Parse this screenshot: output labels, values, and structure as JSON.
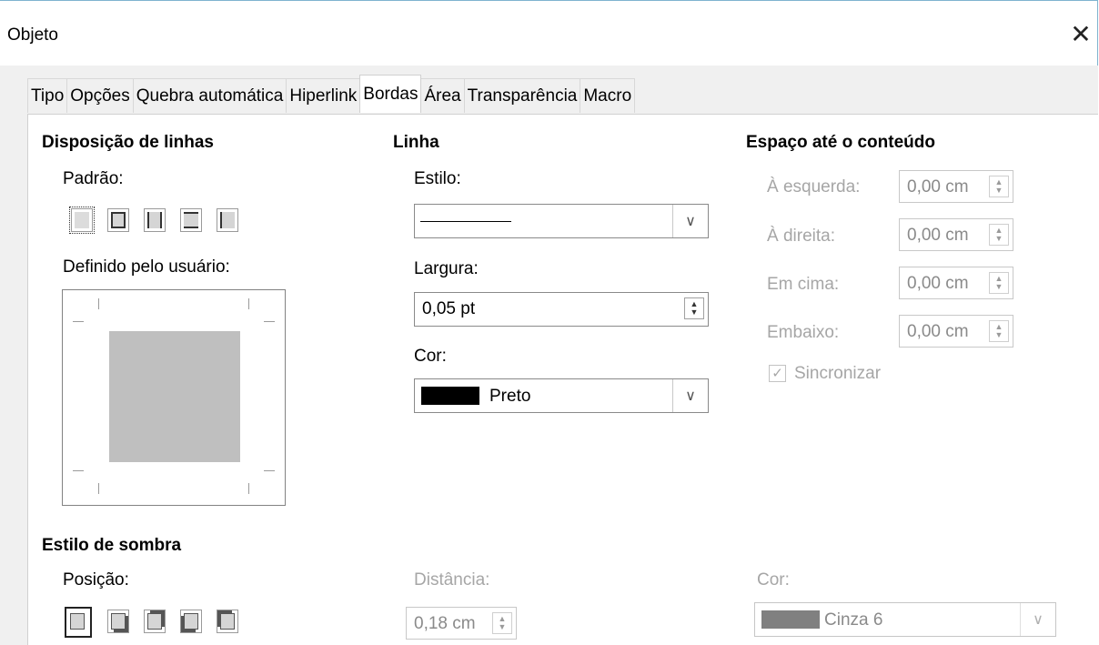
{
  "window": {
    "title": "Objeto",
    "close_glyph": "✕"
  },
  "tabs": [
    {
      "label": "Tipo",
      "active": false
    },
    {
      "label": "Opções",
      "active": false
    },
    {
      "label": "Quebra automática",
      "active": false
    },
    {
      "label": "Hiperlink",
      "active": false
    },
    {
      "label": "Bordas",
      "active": true
    },
    {
      "label": "Área",
      "active": false
    },
    {
      "label": "Transparência",
      "active": false
    },
    {
      "label": "Macro",
      "active": false
    }
  ],
  "line_arrangement": {
    "heading": "Disposição de linhas",
    "default_label": "Padrão:",
    "user_defined_label": "Definido pelo usuário:"
  },
  "line": {
    "heading": "Linha",
    "style_label": "Estilo:",
    "width_label": "Largura:",
    "width_value": "0,05 pt",
    "color_label": "Cor:",
    "color_value": "Preto",
    "color_swatch": "#000000"
  },
  "padding": {
    "heading": "Espaço até o conteúdo",
    "left_label": "À esquerda:",
    "left_value": "0,00 cm",
    "right_label": "À direita:",
    "right_value": "0,00 cm",
    "top_label": "Em cima:",
    "top_value": "0,00 cm",
    "bottom_label": "Embaixo:",
    "bottom_value": "0,00 cm",
    "sync_label": "Sincronizar",
    "sync_checked": true
  },
  "shadow": {
    "heading": "Estilo de sombra",
    "position_label": "Posição:",
    "distance_label": "Distância:",
    "distance_value": "0,18 cm",
    "color_label": "Cor:",
    "color_value": "Cinza 6",
    "color_swatch": "#808080"
  }
}
